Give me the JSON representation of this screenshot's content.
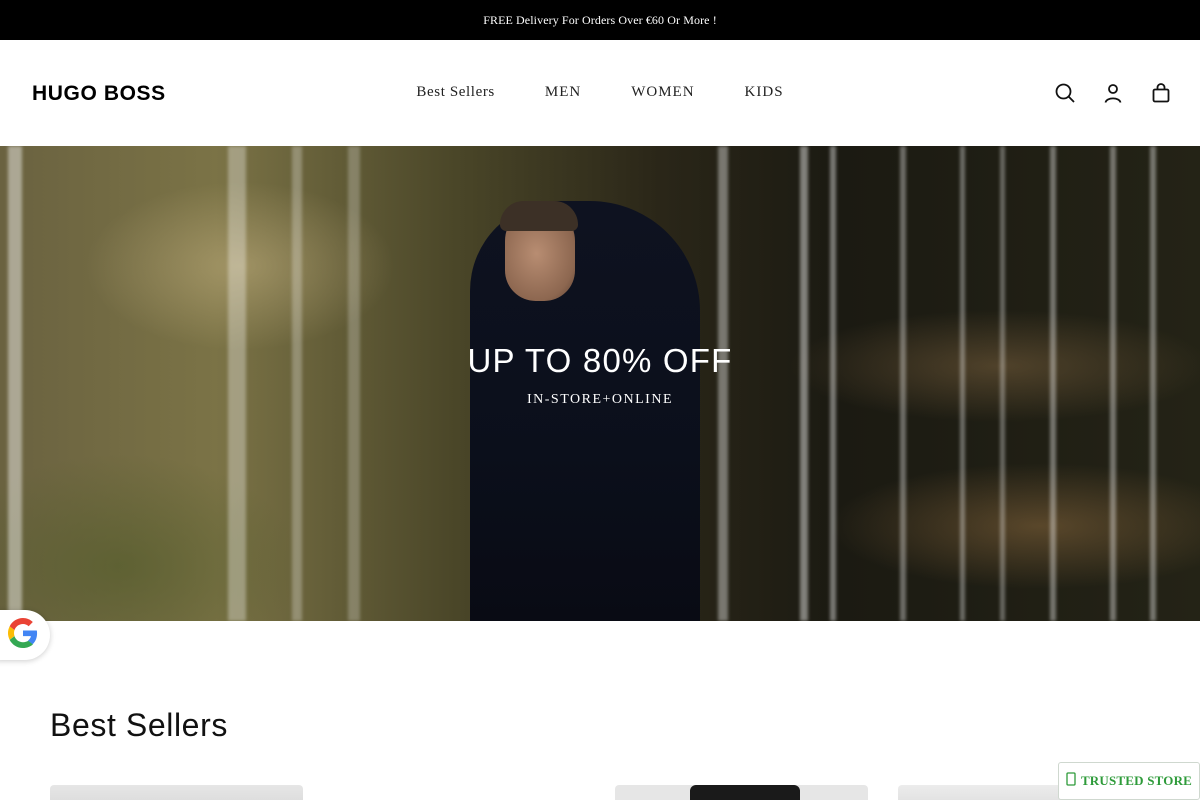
{
  "announcement": {
    "text": "FREE Delivery For Orders Over €60 Or More !"
  },
  "header": {
    "logo": "HUGO BOSS",
    "nav": [
      "Best Sellers",
      "MEN",
      "WOMEN",
      "KIDS"
    ],
    "icons": [
      "search-icon",
      "account-icon",
      "cart-icon"
    ]
  },
  "hero": {
    "title": "UP TO 80% OFF",
    "subtitle": "IN-STORE+ONLINE"
  },
  "google_badge": {
    "icon": "google-icon"
  },
  "best_sellers": {
    "title": "Best Sellers"
  },
  "trust_badge": {
    "label": "TRUSTED STORE",
    "icon": "shield-check-icon",
    "color": "#2e9b3a"
  },
  "colors": {
    "announcement_bg": "#000000",
    "page_bg": "#ffffff",
    "text": "#111111"
  }
}
